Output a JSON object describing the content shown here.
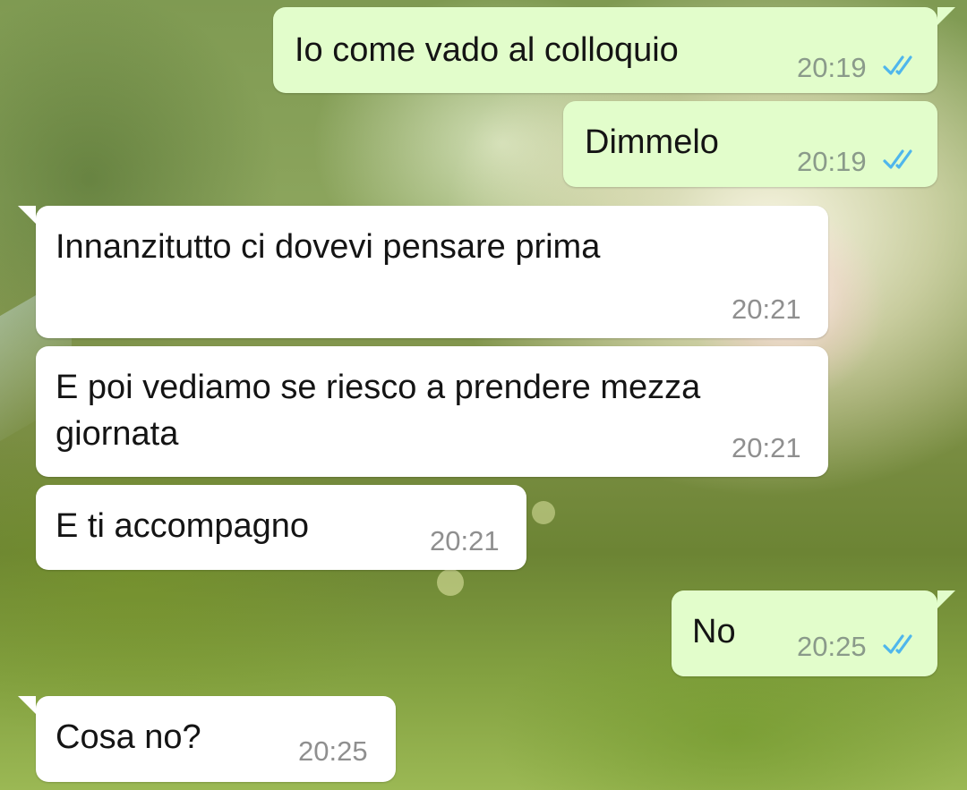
{
  "conversation": {
    "messages": [
      {
        "direction": "outgoing",
        "text": "Io come vado al colloquio",
        "time": "20:19",
        "status": "read"
      },
      {
        "direction": "outgoing",
        "text": "Dimmelo",
        "time": "20:19",
        "status": "read"
      },
      {
        "direction": "incoming",
        "text": "Innanzitutto ci dovevi pensare prima",
        "time": "20:21"
      },
      {
        "direction": "incoming",
        "text": "E poi vediamo se riesco a prendere mezza giornata",
        "time": "20:21"
      },
      {
        "direction": "incoming",
        "text": "E ti accompagno",
        "time": "20:21"
      },
      {
        "direction": "outgoing",
        "text": "No",
        "time": "20:25",
        "status": "read"
      },
      {
        "direction": "incoming",
        "text": "Cosa no?",
        "time": "20:25"
      }
    ]
  },
  "icons": {
    "read_receipt": "double-check-icon"
  },
  "colors": {
    "outgoing_bubble": "#e2fdcb",
    "incoming_bubble": "#ffffff",
    "read_tick": "#4fb6ec",
    "timestamp": "#8f8f8f"
  }
}
